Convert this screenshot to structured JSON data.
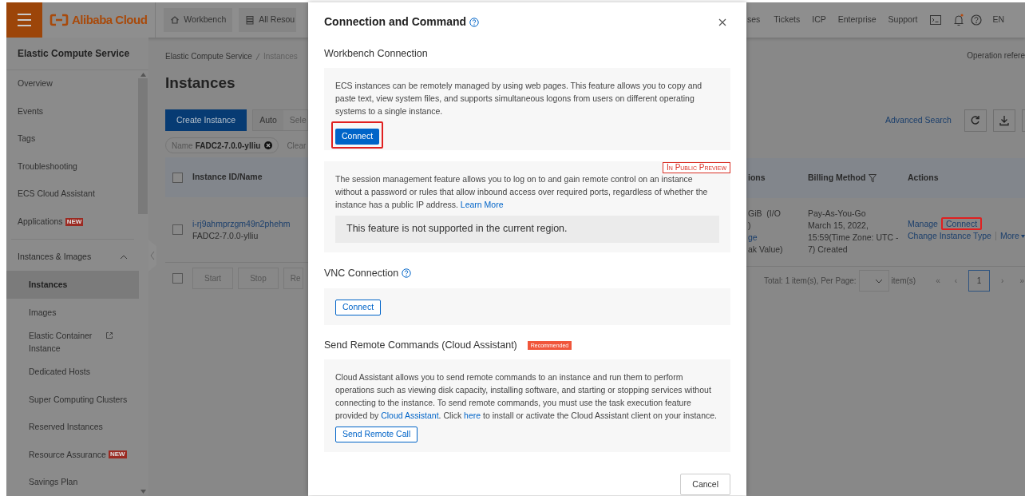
{
  "top_bar": {
    "logo": "Alibaba Cloud",
    "nav_left": [
      {
        "label": "Workbench"
      },
      {
        "label": "All Resou"
      }
    ],
    "nav_right": [
      "ses",
      "Tickets",
      "ICP",
      "Enterprise",
      "Support"
    ],
    "unread_notifications": true,
    "language": "EN"
  },
  "sidebar": {
    "title": "Elastic Compute Service",
    "items": [
      {
        "label": "Overview",
        "selected": false
      },
      {
        "label": "Events",
        "selected": false
      },
      {
        "label": "Tags",
        "selected": false
      },
      {
        "label": "Troubleshooting",
        "selected": false
      },
      {
        "label": "ECS Cloud Assistant",
        "selected": false
      },
      {
        "label": "Applications",
        "selected": false,
        "badge": "NEW"
      }
    ],
    "group": {
      "label": "Instances & Images",
      "expanded": true,
      "children": [
        {
          "label": "Instances",
          "selected": true
        },
        {
          "label": "Images",
          "selected": false
        },
        {
          "label": "Elastic Container Instance",
          "selected": false,
          "external": true
        },
        {
          "label": "Dedicated Hosts",
          "selected": false
        },
        {
          "label": "Super Computing Clusters",
          "selected": false
        },
        {
          "label": "Reserved Instances",
          "selected": false
        },
        {
          "label": "Resource Assurance",
          "selected": false,
          "badge": "NEW"
        },
        {
          "label": "Savings Plan",
          "selected": false
        }
      ]
    }
  },
  "main": {
    "breadcrumb": [
      "Elastic Compute Service",
      "Instances"
    ],
    "heading": "Instances",
    "create_button": "Create Instance",
    "search_mode": {
      "value": "Auto",
      "next": "Sele"
    },
    "filter_tag": {
      "key": "Name",
      "value": "FADC2-7.0.0-ylliu"
    },
    "clear": "Clear",
    "table": {
      "columns": [
        "Instance ID/Name"
      ],
      "header_checked": false,
      "row": {
        "checked": false,
        "instance_id": "i-rj9ahmprzgm49n2phehm",
        "name": "FADC2-7.0.0-ylliu"
      }
    },
    "bulk_checked": false,
    "bulk_actions": [
      "Start",
      "Stop",
      "Re"
    ]
  },
  "right": {
    "operation_reference": "Operation refere",
    "advanced_search": "Advanced Search",
    "columns": [
      {
        "label": "ions",
        "filter": false
      },
      {
        "label": "Billing Method",
        "filter": true
      },
      {
        "label": "Actions",
        "filter": false
      }
    ],
    "config_lines": [
      {
        "text": "GiB  (I/O",
        "link": false
      },
      {
        "text": ")",
        "link": false
      },
      {
        "text": "ge",
        "link": true
      },
      {
        "text": "ak Value)",
        "link": false
      }
    ],
    "billing_lines": [
      "Pay-As-You-Go",
      "March 15, 2022,",
      "15:59(Time Zone: UTC -",
      "7) Created"
    ],
    "actions": [
      {
        "label": "Manage",
        "highlighted": false
      },
      {
        "label": "Connect",
        "highlighted": true
      },
      {
        "label": "Change Instance Type",
        "highlighted": false
      },
      {
        "label": "More",
        "highlighted": false
      }
    ],
    "pagination": {
      "total": "Total: 1 item(s), Per Page:",
      "unit": "item(s)",
      "first": "«",
      "prev": "‹",
      "pages": [
        {
          "label": "1",
          "selected": true
        }
      ],
      "next": "›",
      "last": "»"
    }
  },
  "modal": {
    "title": "Connection and Command",
    "sections": [
      {
        "kind": "workbench",
        "heading": "Workbench Connection",
        "description": [
          {
            "text": "ECS instances can be remotely managed by using web pages. This feature allows you to copy and paste text, view system files, and supports simultaneous logons from users on different operating systems to a single instance.",
            "link": false
          }
        ],
        "button": {
          "label": "Connect",
          "primary": true,
          "highlighted": true
        }
      },
      {
        "kind": "session",
        "badge": "In Public Preview",
        "description": [
          {
            "text": "The session management feature allows you to log on to and gain remote control on an instance without a password or rules that allow inbound access over required ports, regardless of whether the instance has a public IP address. ",
            "link": false
          },
          {
            "text": "Learn More",
            "link": true
          }
        ],
        "notice": "This feature is not supported in the current region."
      },
      {
        "kind": "vnc",
        "heading": "VNC Connection",
        "help": true,
        "button": {
          "label": "Connect",
          "primary": false,
          "highlighted": false
        }
      },
      {
        "kind": "commands",
        "heading": "Send Remote Commands (Cloud Assistant)",
        "tag": "Recommended",
        "description": [
          {
            "text": "Cloud Assistant allows you to send remote commands to an instance and run them to perform operations such as viewing disk capacity, installing software, and starting or stopping services without connecting to the instance. To send remote commands, you must use the task execution feature provided by ",
            "link": false
          },
          {
            "text": "Cloud Assistant",
            "link": true
          },
          {
            "text": ". Click ",
            "link": false
          },
          {
            "text": "here",
            "link": true
          },
          {
            "text": " to install or activate the Cloud Assistant client on your instance.",
            "link": false
          }
        ],
        "button": {
          "label": "Send Remote Call",
          "primary": false,
          "highlighted": false
        }
      }
    ],
    "cancel": "Cancel"
  }
}
